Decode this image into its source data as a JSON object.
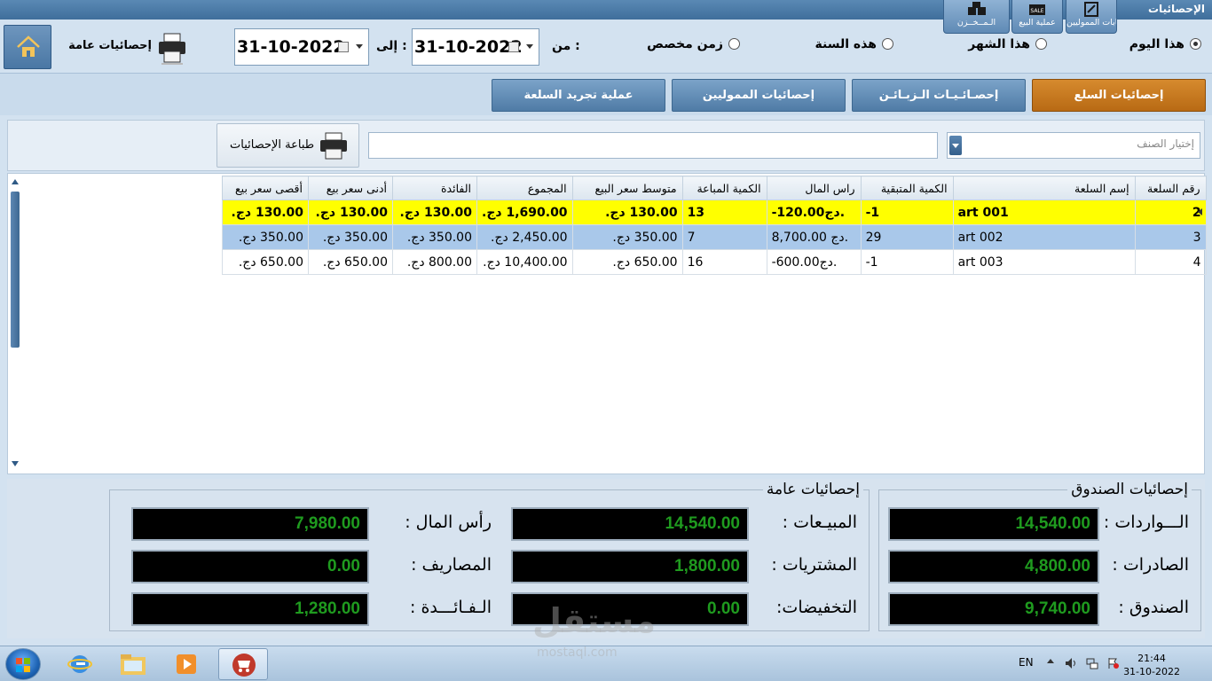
{
  "window": {
    "title": "الإحصائيات"
  },
  "top_buttons": [
    {
      "label": "حسابات المموليين"
    },
    {
      "label": "عملية البيع"
    },
    {
      "label": "الـمــخــزن"
    }
  ],
  "header": {
    "general_stats_label": "إحصائيات عامة",
    "from_label": "من :",
    "to_label": "إلى :",
    "date_from": "31-10-2022",
    "date_to": "31-10-2022",
    "periods": [
      {
        "label": "هذا اليوم",
        "selected": true
      },
      {
        "label": "هذا الشهر",
        "selected": false
      },
      {
        "label": "هذه السنة",
        "selected": false
      },
      {
        "label": "زمن مخصص",
        "selected": false
      }
    ]
  },
  "tabs": [
    {
      "label": "إحصائيات السلع",
      "active": true
    },
    {
      "label": "إحصـائـيـات الـزبـائـن",
      "active": false
    },
    {
      "label": "إحصائيات المموليين",
      "active": false
    },
    {
      "label": "عملية تجريد السلعة",
      "active": false
    }
  ],
  "toolbar": {
    "print_stats_label": "طباعة الإحصائيات",
    "category_placeholder": "إختيار الصنف",
    "search_value": ""
  },
  "grid": {
    "columns": [
      "رقم السلعة",
      "إسم السلعة",
      "الكمية المتبقية",
      "راس المال",
      "الكمية المباعة",
      "متوسط سعر البيع",
      "المجموع",
      "الفائدة",
      "أدنى سعر بيع",
      "أقصى سعر بيع"
    ],
    "rows": [
      {
        "id": "2",
        "name": "art 001",
        "remaining": "-1",
        "capital": "-120.00دج.",
        "sold": "13",
        "avg_price": "130.00 دج.",
        "total": "1,690.00 دج.",
        "profit": "130.00 دج.",
        "min_price": "130.00 دج.",
        "max_price": "130.00 دج."
      },
      {
        "id": "3",
        "name": "art 002",
        "remaining": "29",
        "capital": "8,700.00 دج.",
        "sold": "7",
        "avg_price": "350.00 دج.",
        "total": "2,450.00 دج.",
        "profit": "350.00 دج.",
        "min_price": "350.00 دج.",
        "max_price": "350.00 دج."
      },
      {
        "id": "4",
        "name": "art 003",
        "remaining": "-1",
        "capital": "-600.00دج.",
        "sold": "16",
        "avg_price": "650.00 دج.",
        "total": "10,400.00 دج.",
        "profit": "800.00 دج.",
        "min_price": "650.00 دج.",
        "max_price": "650.00 دج."
      }
    ]
  },
  "cashbox": {
    "title": "إحصائيات الصندوق",
    "income_label": "الـــواردات :",
    "income": "14,540.00",
    "expense_label": "الصادرات :",
    "expense": "4,800.00",
    "box_label": "الصندوق :",
    "box": "9,740.00"
  },
  "general": {
    "title": "إحصائيات عامة",
    "sales_label": "المبيـعات :",
    "sales": "14,540.00",
    "purchases_label": "المشتريات :",
    "purchases": "1,800.00",
    "discounts_label": "التخفيضات:",
    "discounts": "0.00",
    "capital_label": "رأس المال :",
    "capital": "7,980.00",
    "expenses_label": "المصاريف :",
    "expenses": "0.00",
    "profit_label": "الـفـائـــدة :",
    "profit": "1,280.00"
  },
  "watermark": {
    "text": "مستقل",
    "sub": "mostaql.com"
  },
  "taskbar": {
    "lang": "EN",
    "time": "21:44",
    "date": "31-10-2022"
  },
  "colors": {
    "accent_tab": "#c4761e",
    "selected_row": "#a9c8ea",
    "highlight_row": "#ffff00",
    "led_text": "#1f9b1f"
  }
}
